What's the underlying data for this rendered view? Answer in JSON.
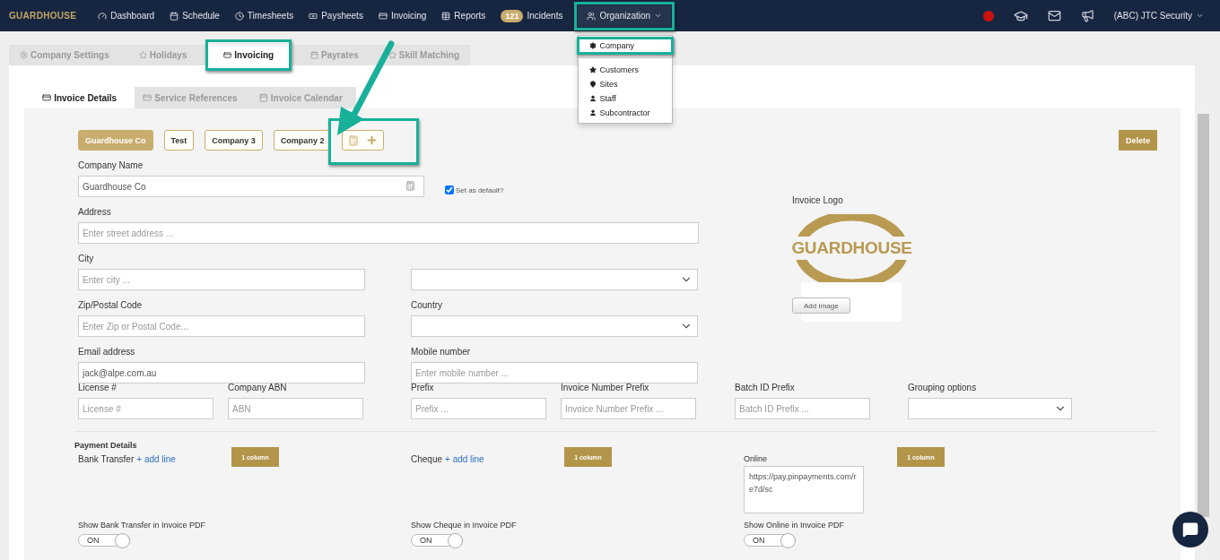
{
  "navbar": {
    "brand": "GUARDHOUSE",
    "links": [
      {
        "label": "Dashboard"
      },
      {
        "label": "Schedule"
      },
      {
        "label": "Timesheets"
      },
      {
        "label": "Paysheets"
      },
      {
        "label": "Invoicing"
      },
      {
        "label": "Reports"
      },
      {
        "label": "Incidents",
        "badge": "121"
      }
    ],
    "menu": {
      "label": "Organization",
      "expanded": true,
      "highlighted": true,
      "items": [
        {
          "label": "Company",
          "highlighted": true
        },
        {
          "label": "Customers",
          "highlighted": false
        },
        {
          "label": "Sites",
          "highlighted": false
        },
        {
          "label": "Staff",
          "highlighted": false
        },
        {
          "label": "Subcontractor",
          "highlighted": false
        }
      ]
    },
    "account": "(ABC) JTC Security"
  },
  "tabs": [
    {
      "label": "Company Settings",
      "selected": false,
      "highlighted": false
    },
    {
      "label": "Holidays",
      "selected": false,
      "highlighted": false
    },
    {
      "label": "Invoicing",
      "selected": true,
      "highlighted": true
    },
    {
      "label": "Payrates",
      "selected": false,
      "highlighted": false
    },
    {
      "label": "Skill Matching",
      "selected": false,
      "highlighted": false
    }
  ],
  "subtabs": [
    {
      "label": "Invoice Details",
      "selected": true
    },
    {
      "label": "Service References",
      "selected": false
    },
    {
      "label": "Invoice Calendar",
      "selected": false
    }
  ],
  "companies": [
    {
      "label": "Guardhouse Co",
      "selected": true
    },
    {
      "label": "Test",
      "selected": false
    },
    {
      "label": "Company 3",
      "selected": false
    },
    {
      "label": "Company 2",
      "selected": false
    }
  ],
  "add_company": {
    "highlighted": true
  },
  "delete_button": "Delete",
  "company_name": {
    "label": "Company Name",
    "value": "Guardhouse Co"
  },
  "set_default": {
    "label": "Set as default?",
    "checked": true
  },
  "address": {
    "label": "Address",
    "placeholder": "Enter street address ..."
  },
  "city": {
    "label": "City",
    "placeholder": "Enter city ..."
  },
  "zip": {
    "label": "Zip/Postal Code",
    "placeholder": "Enter Zip or Postal Code..."
  },
  "country": {
    "label": "Country"
  },
  "email": {
    "label": "Email address",
    "value": "jack@alpe.com.au"
  },
  "mobile": {
    "label": "Mobile number",
    "placeholder": "Enter mobile number ..."
  },
  "row_fields": [
    {
      "kind": "input",
      "label": "License #",
      "placeholder": "License #"
    },
    {
      "kind": "input",
      "label": "Company ABN",
      "placeholder": "ABN"
    },
    {
      "kind": "input",
      "label": "Prefix",
      "placeholder": "Prefix ..."
    },
    {
      "kind": "input",
      "label": "Invoice Number Prefix",
      "placeholder": "Invoice Number Prefix ..."
    },
    {
      "kind": "input",
      "label": "Batch ID Prefix",
      "placeholder": "Batch ID Prefix ..."
    },
    {
      "kind": "select",
      "label": "Grouping options"
    }
  ],
  "logo": {
    "label": "Invoice Logo",
    "logo_text": "GUARDHOUSE",
    "button": "Add Image"
  },
  "payment": {
    "title": "Payment Details",
    "methods": [
      {
        "kind": "link",
        "label": "Bank Transfer",
        "link": "+ add line",
        "button": "1 column",
        "toggle_label": "Show Bank Transfer in Invoice PDF",
        "toggle": {
          "on": true,
          "text": "ON"
        }
      },
      {
        "kind": "link",
        "label": "Cheque",
        "link": "+ add line",
        "button": "1 column",
        "toggle_label": "Show Cheque in Invoice PDF",
        "toggle": {
          "on": true,
          "text": "ON"
        }
      },
      {
        "kind": "textarea",
        "label": "Online",
        "value": "https://pay.pinpayments.com/re7d/sc",
        "button": "1 column",
        "toggle_label": "Show Online in Invoice PDF",
        "toggle": {
          "on": true,
          "text": "ON"
        }
      }
    ]
  }
}
